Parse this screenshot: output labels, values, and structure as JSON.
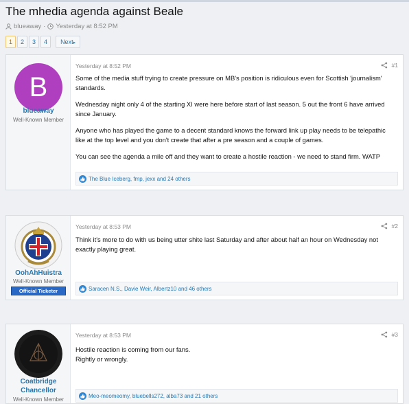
{
  "thread": {
    "title": "The mhedia agenda against Beale",
    "author": "blueaway",
    "separator": "·",
    "time": "Yesterday at 8:52 PM"
  },
  "pager": {
    "pages": [
      "1",
      "2",
      "3",
      "4"
    ],
    "active": "1",
    "next_label": "Next"
  },
  "posts": [
    {
      "username": "blueaway",
      "avatar_letter": "B",
      "avatar_color": "#b03fc0",
      "user_title": "Well-Known Member",
      "date": "Yesterday at 8:52 PM",
      "number": "#1",
      "paragraphs": [
        "Some of the media stuff trying to create pressure on MB's position is ridiculous even for Scottish 'journalism' standards.",
        "Wednesday night only 4 of the starting XI were here before start of last season. 5 out the front 6 have arrived since January.",
        "Anyone who has played the game to a decent standard knows the forward link up play needs to be telepathic like at the top level and you don't create that after a pre season and a couple of games.",
        "You can see the agenda a mile off and they want to create a hostile reaction - we need to stand firm. WATP"
      ],
      "reactions": "The Blue Iceberg, fmp, jexx and 24 others"
    },
    {
      "username": "OohAhHuistra",
      "user_title": "Well-Known Member",
      "banner": "Official Ticketer",
      "date": "Yesterday at 8:53 PM",
      "number": "#2",
      "paragraphs": [
        "Think it's more to do with us being utter shite last Saturday and after about half an hour on Wednesday not exactly playing great."
      ],
      "reactions": "Saracen N.S., Davie Weir, Albertz10 and 46 others"
    },
    {
      "username_line1": "Coatbridge",
      "username_line2": "Chancellor",
      "user_title": "Well-Known Member",
      "date": "Yesterday at 8:53 PM",
      "number": "#3",
      "paragraphs": [
        "Hostile reaction is coming from our fans.",
        "Rightly or wrongly."
      ],
      "reactions": "Meo-meomeomy, bluebells272, alba73 and 21 others"
    }
  ],
  "colors": {
    "link": "#2577b1",
    "page_bg": "#eef0f3",
    "banner_bg": "#2a68c6"
  },
  "icons": {
    "author": "user-icon",
    "time": "clock-icon",
    "share": "share-icon",
    "like": "like-icon"
  }
}
